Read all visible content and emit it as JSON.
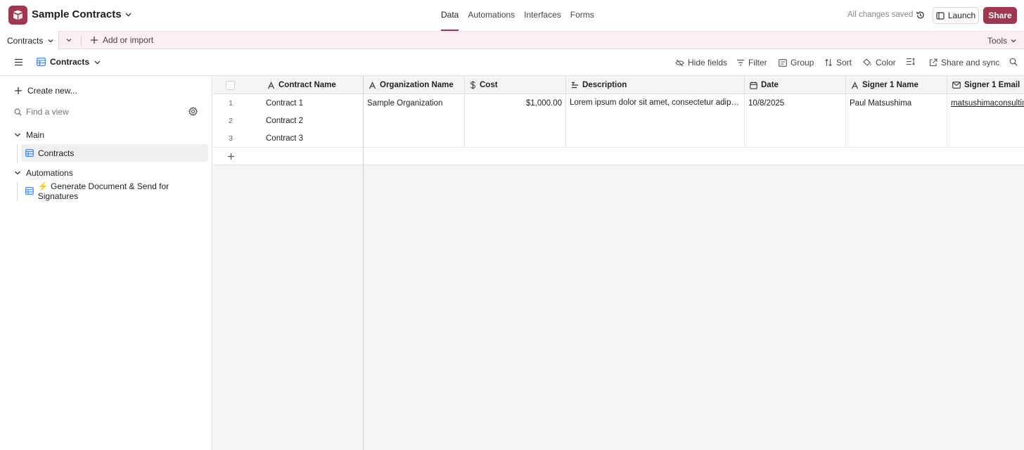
{
  "app": {
    "base_name": "Sample Contracts",
    "brand_color": "#a0374f",
    "nav": [
      "Data",
      "Automations",
      "Interfaces",
      "Forms"
    ],
    "active_nav": "Data",
    "status": "All changes saved",
    "launch_label": "Launch",
    "share_label": "Share"
  },
  "tabbar": {
    "active_table": "Contracts",
    "add_import_label": "Add or import",
    "tools_label": "Tools"
  },
  "viewbar": {
    "view_name": "Contracts",
    "hide_fields": "Hide fields",
    "filter": "Filter",
    "group": "Group",
    "sort": "Sort",
    "color": "Color",
    "share_sync": "Share and sync"
  },
  "sidebar": {
    "create_new": "Create new...",
    "find_placeholder": "Find a view",
    "sections": [
      {
        "name": "Main",
        "items": [
          "Contracts"
        ]
      },
      {
        "name": "Automations",
        "items": [
          "⚡ Generate Document & Send for Signatures"
        ]
      }
    ]
  },
  "grid": {
    "columns": [
      "Contract Name",
      "Organization Name",
      "Cost",
      "Description",
      "Date",
      "Signer 1 Name",
      "Signer 1 Email"
    ],
    "column_icons": [
      "text-icon",
      "text-icon",
      "currency-icon",
      "long-text-icon",
      "calendar-icon",
      "text-icon",
      "email-icon"
    ],
    "rows": [
      {
        "num": "1",
        "cells": [
          "Contract 1",
          "Sample Organization",
          "$1,000.00",
          "Lorem ipsum dolor sit amet, consectetur adipiscing elit",
          "10/8/2025",
          "Paul Matsushima",
          "matsushimaconsulting"
        ]
      },
      {
        "num": "2",
        "cells": [
          "Contract 2",
          "",
          "",
          "",
          "",
          "",
          ""
        ]
      },
      {
        "num": "3",
        "cells": [
          "Contract 3",
          "",
          "",
          "",
          "",
          "",
          ""
        ]
      }
    ]
  }
}
